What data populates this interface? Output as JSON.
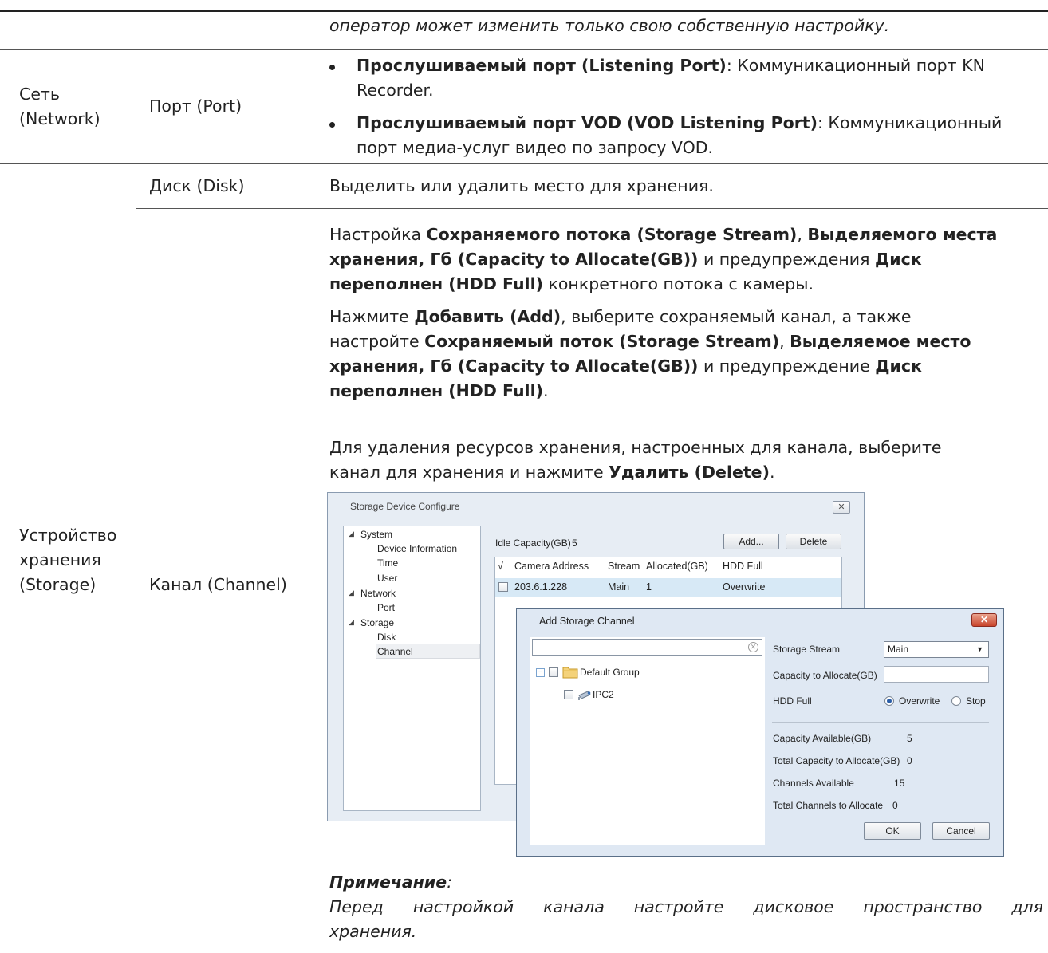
{
  "row0": {
    "col3_italic": "оператор может изменить только свою собственную настройку."
  },
  "network": {
    "col1_line1": "Сеть",
    "col1_line2": "(Network)",
    "col2": "Порт (Port)",
    "b1_bold": "Прослушиваемый порт (Listening Port)",
    "b1_rest": ": Коммуникационный порт KN",
    "b1_line2": "Recorder.",
    "b2_bold": "Прослушиваемый порт VOD (VOD Listening Port)",
    "b2_rest": ": Коммуникационный",
    "b2_line2": "порт медиа-услуг видео по запросу VOD."
  },
  "storage": {
    "col1_line1": "Устройство",
    "col1_line2": "хранения",
    "col1_line3": "(Storage)",
    "disk_label": "Диск (Disk)",
    "disk_desc": "Выделить или удалить место для хранения.",
    "channel_label": "Канал (Channel)",
    "p1": {
      "l1_a": "Настройка ",
      "l1_b": "Сохраняемого потока (Storage Stream)",
      "l1_c": ", ",
      "l1_d": "Выделяемого места",
      "l2_a": "хранения, Гб (Capacity to Allocate(GB))",
      "l2_b": " и предупреждения ",
      "l2_c": "Диск",
      "l3_a": "переполнен (HDD Full)",
      "l3_b": " конкретного потока с камеры."
    },
    "p2": {
      "l1_a": "Нажмите ",
      "l1_b": "Добавить (Add)",
      "l1_c": ", выберите сохраняемый канал, а также",
      "l2_a": "настройте ",
      "l2_b": "Сохраняемый поток (Storage Stream)",
      "l2_c": ", ",
      "l2_d": "Выделяемое место",
      "l3_a": "хранения, Гб (Capacity to Allocate(GB))",
      "l3_b": " и предупреждение ",
      "l3_c": "Диск",
      "l4_a": "переполнен (HDD Full)",
      "l4_b": "."
    },
    "p3": {
      "l1": "Для удаления ресурсов хранения, настроенных для канала, выберите",
      "l2_a": "канал для хранения и нажмите ",
      "l2_b": "Удалить (Delete)",
      "l2_c": "."
    },
    "note_title": "Примечание",
    "note_colon": ":",
    "note_l1": "Перед настройкой канала настройте дисковое пространство для",
    "note_l2": "хранения."
  },
  "sdc_window": {
    "title": "Storage Device Configure",
    "close": "✕",
    "tree": [
      "System",
      "Device Information",
      "Time",
      "User",
      "Network",
      "Port",
      "Storage",
      "Disk",
      "Channel"
    ],
    "idle_label": "Idle Capacity(GB)",
    "idle_value": "5",
    "add_button": "Add...",
    "delete_button": "Delete",
    "headers": [
      "√",
      "Camera Address",
      "Stream",
      "Allocated(GB)",
      "HDD Full"
    ],
    "row": {
      "address": "203.6.1.228",
      "stream": "Main",
      "allocated": "1",
      "hdd_full": "Overwrite"
    }
  },
  "asc_dialog": {
    "title": "Add Storage Channel",
    "close": "✕",
    "search_placeholder": "",
    "group": "Default Group",
    "camera": "IPC2",
    "storage_stream_label": "Storage Stream",
    "storage_stream_value": "Main",
    "capacity_label": "Capacity to Allocate(GB)",
    "hdd_label": "HDD Full",
    "overwrite": "Overwrite",
    "stop": "Stop",
    "cap_avail_label": "Capacity Available(GB)",
    "cap_avail_value": "5",
    "total_cap_label": "Total Capacity to Allocate(GB)",
    "total_cap_value": "0",
    "ch_avail_label": "Channels Available",
    "ch_avail_value": "15",
    "total_ch_label": "Total Channels to Allocate",
    "total_ch_value": "0",
    "ok": "OK",
    "cancel": "Cancel"
  }
}
